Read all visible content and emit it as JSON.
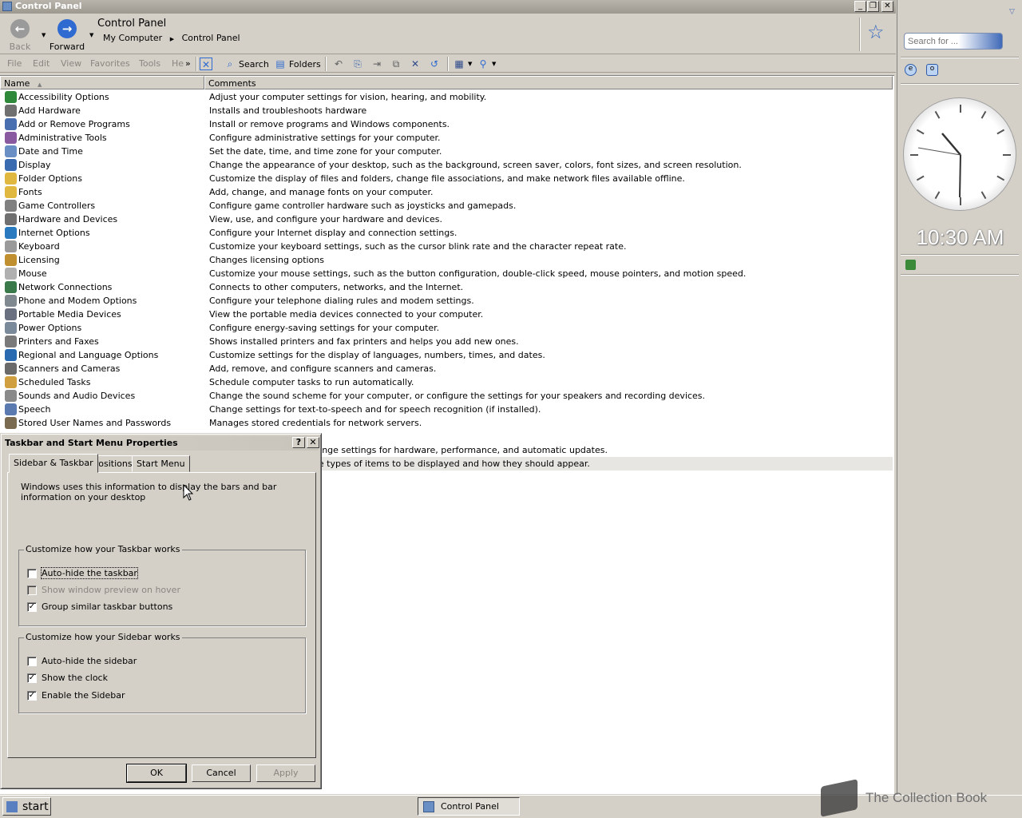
{
  "window": {
    "title": "Control Panel"
  },
  "toolbar": {
    "back_label": "Back",
    "forward_label": "Forward",
    "address_title": "Control Panel",
    "breadcrumbs": [
      "My Computer",
      "Control Panel"
    ]
  },
  "menu": {
    "items": [
      "File",
      "Edit",
      "View",
      "Favorites",
      "Tools",
      "He"
    ],
    "search_label": "Search",
    "folders_label": "Folders"
  },
  "list": {
    "columns": [
      "Name",
      "Comments"
    ],
    "rows": [
      {
        "name": "Accessibility Options",
        "comment": "Adjust your computer settings for vision, hearing, and mobility.",
        "color": "#2e8a3a"
      },
      {
        "name": "Add Hardware",
        "comment": "Installs and troubleshoots hardware",
        "color": "#707070"
      },
      {
        "name": "Add or Remove Programs",
        "comment": "Install or remove programs and Windows components.",
        "color": "#4a6fb0"
      },
      {
        "name": "Administrative Tools",
        "comment": "Configure administrative settings for your computer.",
        "color": "#8a5aa0"
      },
      {
        "name": "Date and Time",
        "comment": "Set the date, time, and time zone for your computer.",
        "color": "#6a8fc4"
      },
      {
        "name": "Display",
        "comment": "Change the appearance of your desktop, such as the background, screen saver, colors, font sizes, and screen resolution.",
        "color": "#3a6ab0"
      },
      {
        "name": "Folder Options",
        "comment": "Customize the display of files and folders, change file associations, and make network files available offline.",
        "color": "#e0b840"
      },
      {
        "name": "Fonts",
        "comment": "Add, change, and manage fonts on your computer.",
        "color": "#e0b840"
      },
      {
        "name": "Game Controllers",
        "comment": "Configure game controller hardware such as joysticks and gamepads.",
        "color": "#808080"
      },
      {
        "name": "Hardware and Devices",
        "comment": "View, use, and configure your hardware and devices.",
        "color": "#707070"
      },
      {
        "name": "Internet Options",
        "comment": "Configure your Internet display and connection settings.",
        "color": "#2a7ac0"
      },
      {
        "name": "Keyboard",
        "comment": "Customize your keyboard settings, such as the cursor blink rate and the character repeat rate.",
        "color": "#9a9a9a"
      },
      {
        "name": "Licensing",
        "comment": "Changes licensing options",
        "color": "#c09030"
      },
      {
        "name": "Mouse",
        "comment": "Customize your mouse settings, such as the button configuration, double-click speed, mouse pointers, and motion speed.",
        "color": "#b0b0b0"
      },
      {
        "name": "Network Connections",
        "comment": "Connects to other computers, networks, and the Internet.",
        "color": "#3a7a4a"
      },
      {
        "name": "Phone and Modem Options",
        "comment": "Configure your telephone dialing rules and modem settings.",
        "color": "#808890"
      },
      {
        "name": "Portable Media Devices",
        "comment": "View the portable media devices connected to your computer.",
        "color": "#6a7080"
      },
      {
        "name": "Power Options",
        "comment": "Configure energy-saving settings for your computer.",
        "color": "#7a8a9a"
      },
      {
        "name": "Printers and Faxes",
        "comment": "Shows installed printers and fax printers and helps you add new ones.",
        "color": "#7a7a7a"
      },
      {
        "name": "Regional and Language Options",
        "comment": "Customize settings for the display of languages, numbers, times, and dates.",
        "color": "#2a6ab0"
      },
      {
        "name": "Scanners and Cameras",
        "comment": "Add, remove, and configure scanners and cameras.",
        "color": "#6a6a6a"
      },
      {
        "name": "Scheduled Tasks",
        "comment": "Schedule computer tasks to run automatically.",
        "color": "#d0a040"
      },
      {
        "name": "Sounds and Audio Devices",
        "comment": "Change the sound scheme for your computer, or configure the settings for your speakers and recording devices.",
        "color": "#8a8a8a"
      },
      {
        "name": "Speech",
        "comment": "Change settings for text-to-speech and for speech recognition (if installed).",
        "color": "#5a7ab0"
      },
      {
        "name": "Stored User Names and Passwords",
        "comment": "Manages stored credentials for network servers.",
        "color": "#7a6a50"
      },
      {
        "name": "",
        "comment": "",
        "color": "#ffffff"
      },
      {
        "name": "",
        "comment": "omputer system, and change settings for hardware, performance, and automatic updates.",
        "color": "#ffffff"
      },
      {
        "name": "",
        "comment": "d the taskbar, such as the types of items to be displayed and how they should appear.",
        "color": "#ffffff",
        "selected": true
      }
    ]
  },
  "dialog": {
    "title": "Taskbar and Start Menu Properties",
    "help_btn": "?",
    "close_btn": "✕",
    "tabs": [
      "Sidebar & Taskbar",
      "Positions",
      "Start Menu"
    ],
    "intro": "Windows uses this information to display the bars and bar information on your desktop",
    "taskbar_group": {
      "title": "Customize how your Taskbar works",
      "options": [
        {
          "label": "Auto-hide the taskbar",
          "checked": false,
          "disabled": false
        },
        {
          "label": "Show window preview on hover",
          "checked": false,
          "disabled": true
        },
        {
          "label": "Group similar taskbar buttons",
          "checked": true,
          "disabled": false
        }
      ]
    },
    "sidebar_group": {
      "title": "Customize how your Sidebar works",
      "options": [
        {
          "label": "Auto-hide the sidebar",
          "checked": false
        },
        {
          "label": "Show the clock",
          "checked": true
        },
        {
          "label": "Enable the Sidebar",
          "checked": true
        }
      ]
    },
    "buttons": {
      "ok": "OK",
      "cancel": "Cancel",
      "apply": "Apply"
    }
  },
  "taskbar": {
    "start_label": "start",
    "task_label": "Control Panel",
    "watermark": "The Collection Book"
  },
  "sidebar": {
    "search_placeholder": "Search for ...",
    "clock_time": "10:30 AM"
  }
}
